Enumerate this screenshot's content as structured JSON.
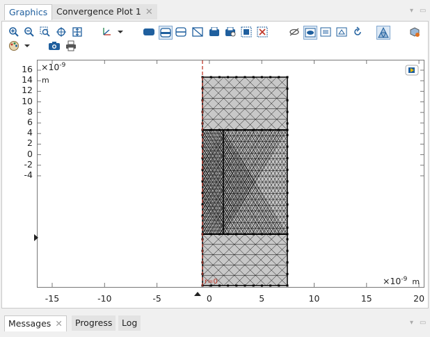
{
  "tabs": [
    {
      "label": "Graphics"
    },
    {
      "label": "Convergence Plot 1"
    }
  ],
  "bottom_tabs": [
    {
      "label": "Messages"
    },
    {
      "label": "Progress"
    },
    {
      "label": "Log"
    }
  ],
  "plot": {
    "y_exponent": "×10",
    "y_exp_power": "-9",
    "y_unit": "m",
    "x_exponent": "×10",
    "x_exp_power": "-9",
    "x_unit": "m",
    "y_ticks": [
      "16",
      "14",
      "12",
      "10",
      "8",
      "6",
      "4",
      "2",
      "0",
      "-2",
      "-4"
    ],
    "x_ticks": [
      "-15",
      "-10",
      "-5",
      "0",
      "5",
      "10",
      "15",
      "20"
    ],
    "axis_marker": "r=0"
  },
  "colors": {
    "mesh_fill": "#c8c8c8",
    "mesh_line": "#000000",
    "axis_line": "#c0392b",
    "active_tab": "#1f5f9e"
  }
}
